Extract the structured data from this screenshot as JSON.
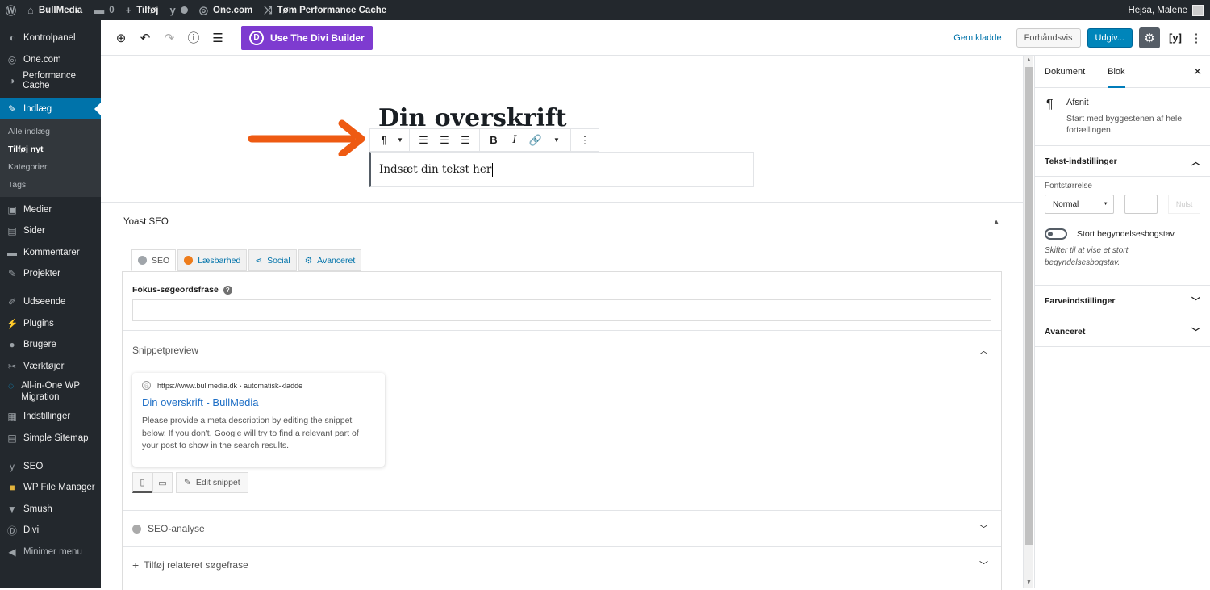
{
  "adminbar": {
    "site_name": "BullMedia",
    "comments_count": "0",
    "new_label": "Tilføj",
    "onecom_label": "One.com",
    "cache_label": "Tøm Performance Cache",
    "greeting": "Hejsa, Malene"
  },
  "sidebar": {
    "items_top": [
      {
        "label": "Kontrolpanel",
        "icon": "dashboard-icon"
      },
      {
        "label": "One.com",
        "icon": "onecom-icon"
      },
      {
        "label": "Performance Cache",
        "icon": "cache-icon"
      }
    ],
    "active": {
      "label": "Indlæg",
      "icon": "pin-icon"
    },
    "submenu": [
      "Alle indlæg",
      "Tilføj nyt",
      "Kategorier",
      "Tags"
    ],
    "items": [
      {
        "label": "Medier"
      },
      {
        "label": "Sider"
      },
      {
        "label": "Kommentarer"
      },
      {
        "label": "Projekter"
      },
      {
        "label": "Udseende"
      },
      {
        "label": "Plugins"
      },
      {
        "label": "Brugere"
      },
      {
        "label": "Værktøjer"
      },
      {
        "label": "All-in-One WP Migration"
      },
      {
        "label": "Indstillinger"
      },
      {
        "label": "Simple Sitemap"
      },
      {
        "label": "SEO"
      },
      {
        "label": "WP File Manager"
      },
      {
        "label": "Smush"
      },
      {
        "label": "Divi"
      },
      {
        "label": "Minimer menu"
      }
    ]
  },
  "topbar": {
    "divi_label": "Use The Divi Builder",
    "save_draft": "Gem kladde",
    "preview": "Forhåndsvis",
    "publish": "Udgiv..."
  },
  "editor": {
    "title": "Din overskrift",
    "paragraph": "Indsæt din tekst her"
  },
  "yoast": {
    "header": "Yoast SEO",
    "tabs": [
      {
        "label": "SEO",
        "dot_color": "#a0a5aa"
      },
      {
        "label": "Læsbarhed",
        "dot_color": "#ee7c1b"
      },
      {
        "label": "Social"
      },
      {
        "label": "Avanceret"
      }
    ],
    "focus_label": "Fokus-søgeordsfrase",
    "snippet_header": "Snippetpreview",
    "snippet": {
      "url": "https://www.bullmedia.dk › automatisk-kladde",
      "title": "Din overskrift - BullMedia",
      "description": "Please provide a meta description by editing the snippet below. If you don't, Google will try to find a relevant part of your post to show in the search results."
    },
    "edit_snippet": "Edit snippet",
    "seo_analysis": "SEO-analyse",
    "related_phrase": "Tilføj relateret søgefrase"
  },
  "panel": {
    "tab_document": "Dokument",
    "tab_block": "Blok",
    "block_title": "Afsnit",
    "block_desc": "Start med byggestenen af hele fortællingen.",
    "text_settings": "Tekst-indstillinger",
    "font_size_label": "Fontstørrelse",
    "font_size_value": "Normal",
    "reset": "Nulst",
    "dropcap_label": "Stort begyndelsesbogstav",
    "dropcap_help": "Skifter til at vise et stort begyndelsesbogstav.",
    "color_settings": "Farveindstillinger",
    "advanced": "Avanceret"
  },
  "colors": {
    "accent": "#0073aa",
    "divi": "#7e3bd0",
    "arrow": "#ee5a12"
  }
}
